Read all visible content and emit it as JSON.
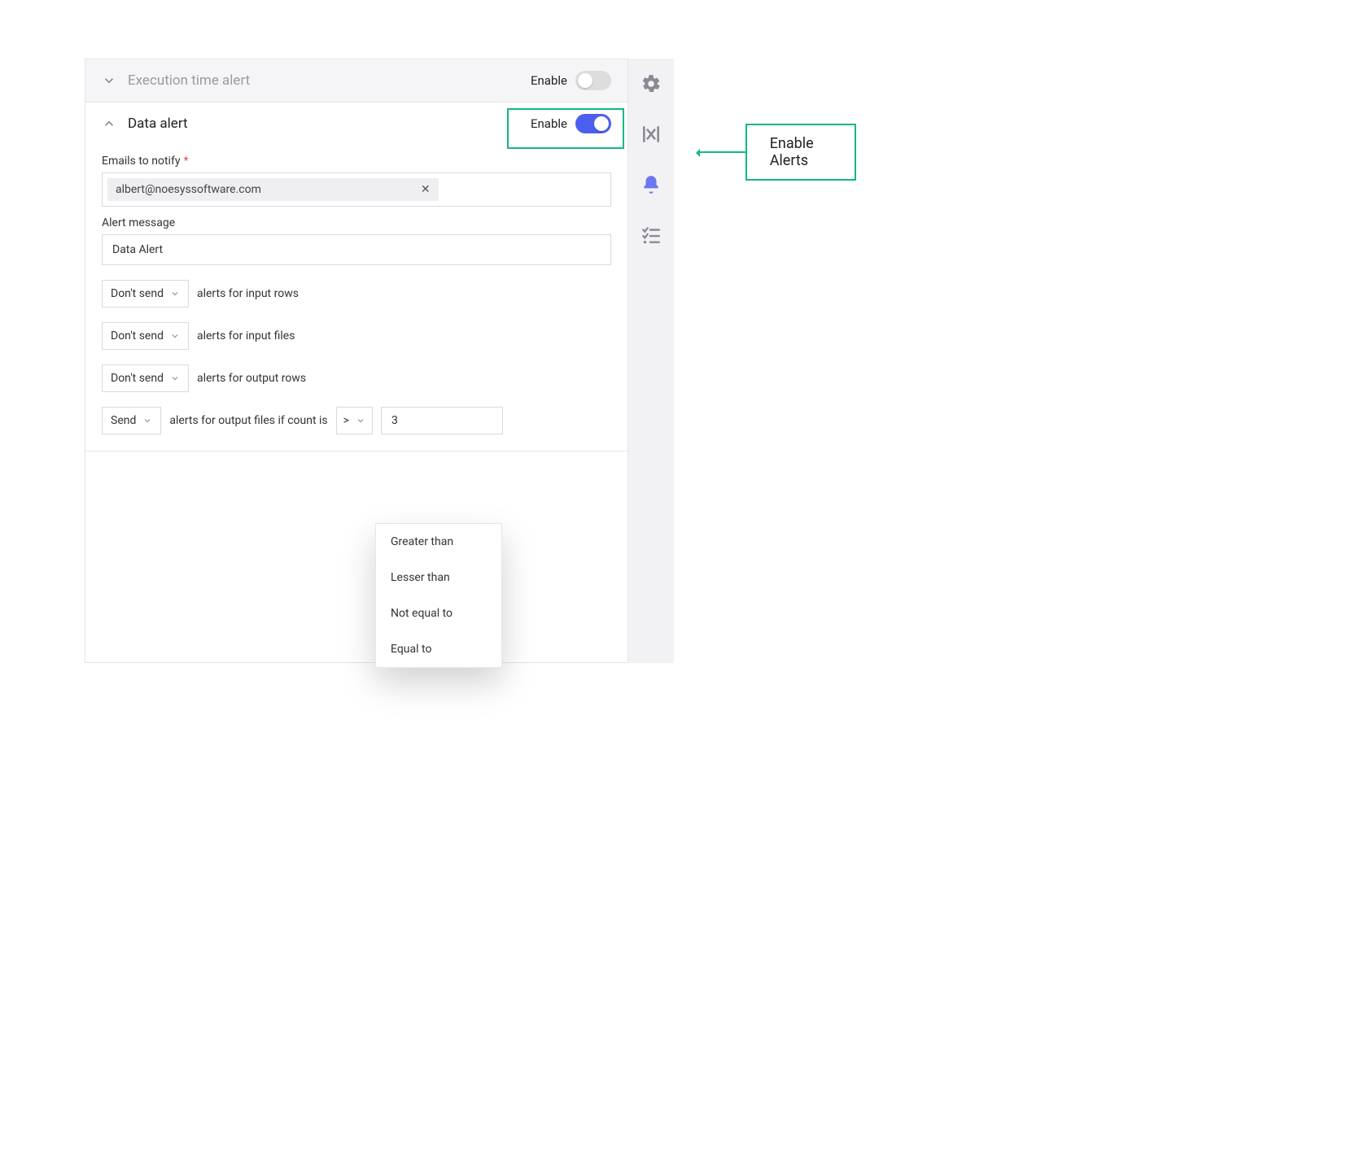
{
  "sections": {
    "execution_time": {
      "title": "Execution time alert",
      "enable_label": "Enable",
      "enabled": false
    },
    "data_alert": {
      "title": "Data alert",
      "enable_label": "Enable",
      "enabled": true
    }
  },
  "fields": {
    "emails_label": "Emails to notify",
    "emails_required_mark": "*",
    "email_chip": "albert@noesyssoftware.com",
    "alert_message_label": "Alert message",
    "alert_message_value": "Data Alert"
  },
  "rules": {
    "input_rows": {
      "action": "Don't send",
      "suffix": "alerts for input rows"
    },
    "input_files": {
      "action": "Don't send",
      "suffix": "alerts for input files"
    },
    "output_rows": {
      "action": "Don't send",
      "suffix": "alerts for output rows"
    },
    "output_files": {
      "action": "Send",
      "suffix": "alerts for output files if count is",
      "operator": ">",
      "value": "3"
    }
  },
  "operator_options": [
    "Greater than",
    "Lesser than",
    "Not equal to",
    "Equal to"
  ],
  "sidebar_icons": [
    "gear-icon",
    "absolute-x-icon",
    "bell-icon",
    "checklist-icon"
  ],
  "annotation": {
    "label": "Enable Alerts"
  },
  "colors": {
    "accent": "#4a5ff0",
    "highlight": "#10b981"
  }
}
